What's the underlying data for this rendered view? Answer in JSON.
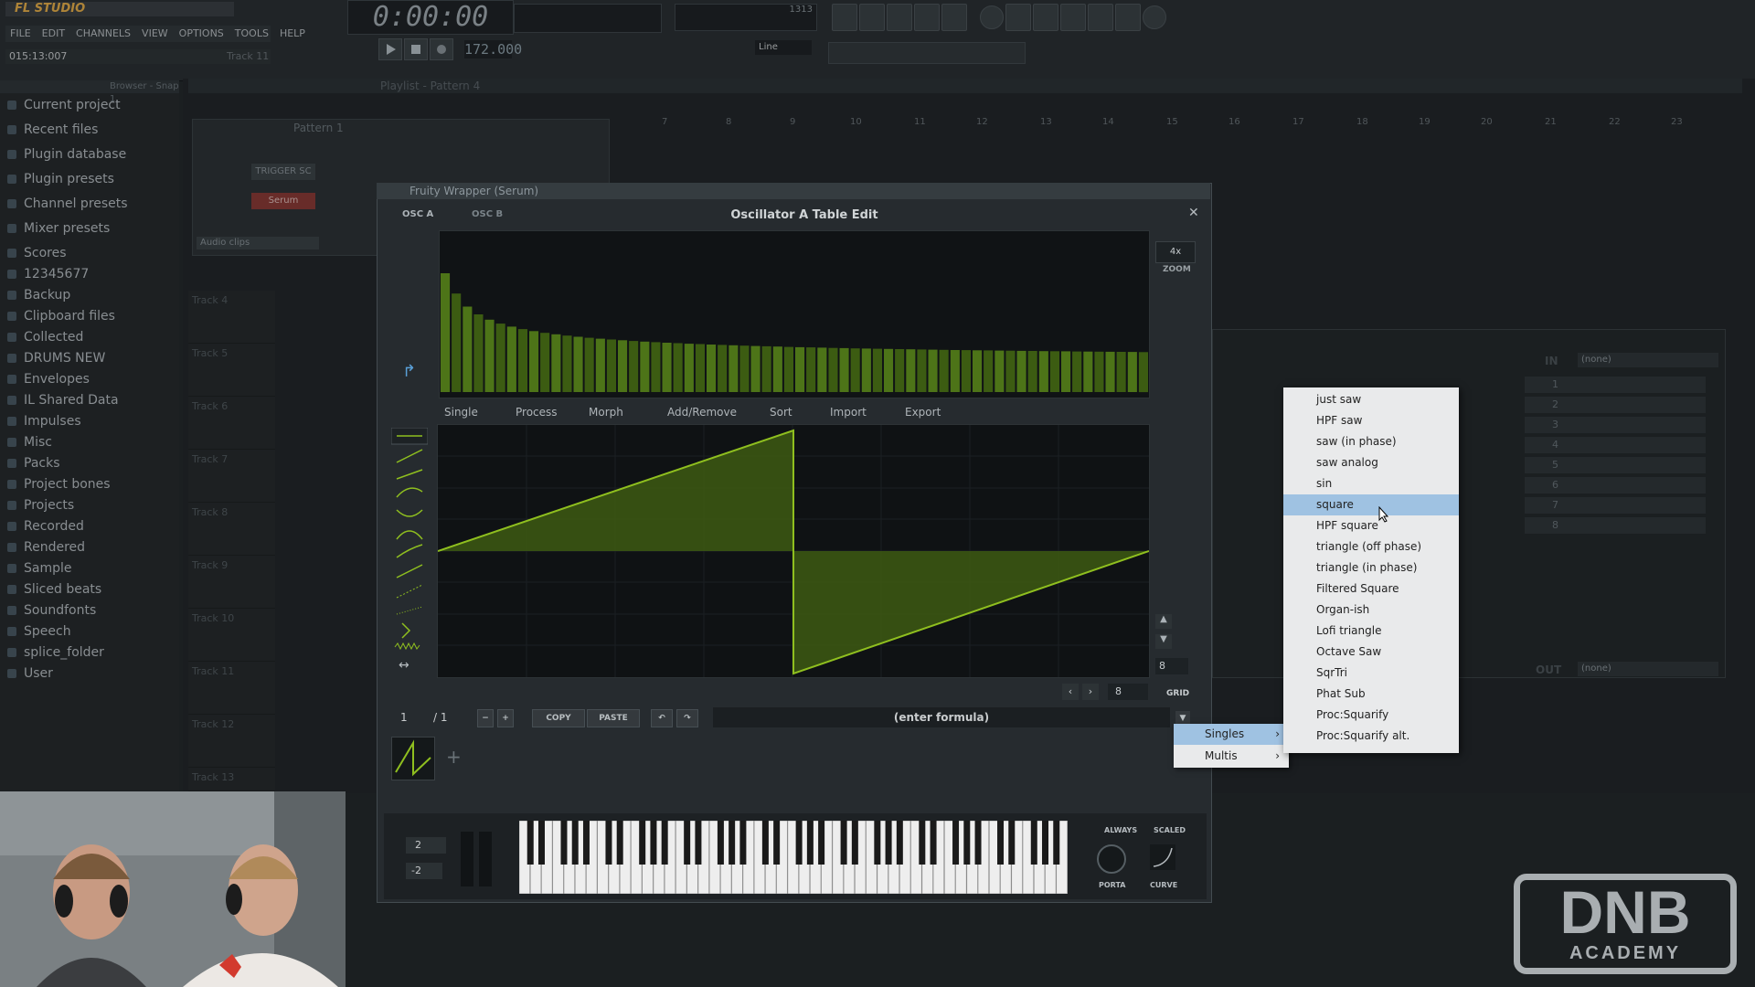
{
  "app": {
    "logo_text": "FL STUDIO",
    "menu": [
      "FILE",
      "EDIT",
      "CHANNELS",
      "VIEW",
      "OPTIONS",
      "TOOLS",
      "HELP"
    ],
    "song_time": "015:13:007",
    "track_hint": "Track 11",
    "transport_time": "0:00:00",
    "tempo": "172.000",
    "cpu_ram": "1313",
    "line_mode": "Line"
  },
  "browser": {
    "header": "Browser - Snap 1",
    "items": [
      {
        "label": "Current project"
      },
      {
        "label": "Recent files"
      },
      {
        "label": "Plugin database"
      },
      {
        "label": "Plugin presets"
      },
      {
        "label": "Channel presets"
      },
      {
        "label": "Mixer presets"
      },
      {
        "label": "Scores"
      },
      {
        "label": "12345677"
      },
      {
        "label": "Backup"
      },
      {
        "label": "Clipboard files"
      },
      {
        "label": "Collected"
      },
      {
        "label": "DRUMS NEW"
      },
      {
        "label": "Envelopes"
      },
      {
        "label": "IL Shared Data"
      },
      {
        "label": "Impulses"
      },
      {
        "label": "Misc"
      },
      {
        "label": "Packs"
      },
      {
        "label": "Project bones"
      },
      {
        "label": "Projects"
      },
      {
        "label": "Recorded"
      },
      {
        "label": "Rendered"
      },
      {
        "label": "Sample"
      },
      {
        "label": "Sliced beats"
      },
      {
        "label": "Soundfonts"
      },
      {
        "label": "Speech"
      },
      {
        "label": "splice_folder"
      },
      {
        "label": "User"
      }
    ]
  },
  "playlist": {
    "title": "Playlist - Pattern 4",
    "bar_numbers": [
      "7",
      "8",
      "9",
      "10",
      "11",
      "12",
      "13",
      "14",
      "15",
      "16",
      "17",
      "18",
      "19",
      "20",
      "21",
      "22",
      "23"
    ],
    "tracks": [
      "Track 4",
      "Track 5",
      "Track 6",
      "Track 7",
      "Track 8",
      "Track 9",
      "Track 10",
      "Track 11",
      "Track 12",
      "Track 13"
    ]
  },
  "channel_rack": {
    "pattern": "Pattern 1",
    "channels": [
      "TRIGGER SC",
      "Serum"
    ],
    "filter": "Audio clips"
  },
  "serum": {
    "window_title": "Fruity Wrapper (Serum)",
    "heading": "Oscillator A Table Edit",
    "osc_tabs": [
      "OSC A",
      "OSC B"
    ],
    "zoom_value": "4x",
    "zoom_label": "ZOOM",
    "wave_menus": [
      "Single",
      "Process",
      "Morph",
      "Add/Remove",
      "Sort",
      "Import",
      "Export"
    ],
    "grid_value": "8",
    "grid_label": "GRID",
    "frame_current": "1",
    "frame_total": "/ 1",
    "copy_label": "COPY",
    "paste_label": "PASTE",
    "formula_placeholder": "(enter formula)",
    "pitch_up": "2",
    "pitch_down": "-2",
    "always_label": "ALWAYS",
    "scaled_label": "SCALED",
    "porta_label": "PORTA",
    "curve_label": "CURVE",
    "step_value": "8"
  },
  "mixer": {
    "in_label": "IN",
    "in_value": "(none)",
    "out_label": "OUT",
    "out_value": "(none)",
    "slots": [
      "1",
      "2",
      "3",
      "4",
      "5",
      "6",
      "7",
      "8"
    ]
  },
  "import_submenu": {
    "items": [
      "Singles",
      "Multis"
    ],
    "highlighted": "Singles"
  },
  "preset_menu": {
    "items": [
      "just saw",
      "HPF saw",
      "saw (in phase)",
      "saw analog",
      "sin",
      "square",
      "HPF square",
      "triangle (off phase)",
      "triangle (in phase)",
      "Filtered Square",
      "Organ-ish",
      "Lofi triangle",
      "Octave Saw",
      "SqrTri",
      "Phat Sub",
      "Proc:Squarify",
      "Proc:Squarify alt."
    ],
    "selected": "square"
  },
  "watermark": {
    "main": "DNB",
    "sub": "ACADEMY"
  },
  "colors": {
    "wave_green": "#8fbf1f",
    "wave_fill": "#3d5a12",
    "menu_highlight": "#9fc2e2",
    "accent_orange": "#e8b04a"
  }
}
